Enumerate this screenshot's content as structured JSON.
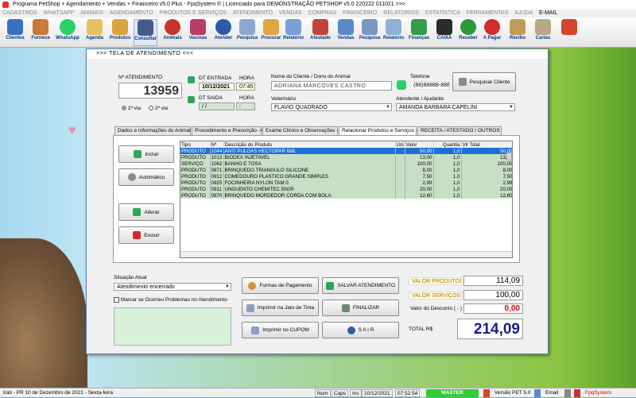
{
  "titlebar": {
    "text": "Programa PetShop + Agendamento + Vendas + Financeiro v5.0 Plus - FpqSystem ® | Licenciado para  DEMONSTRAÇÃO PETSHOP v5.0 220222 011021 >>>"
  },
  "menu": [
    "CADASTROS",
    "WHATSAPP",
    "ANIMAIS",
    "AGENDAMENTO",
    "PRODUTOS E SERVIÇOS",
    "ATENDIMENTO",
    "VENDAS",
    "COMPRAS",
    "FINANCEIRO",
    "RELATÓRIOS",
    "ESTATÍSTICA",
    "FERRAMENTAS",
    "AJUDA",
    "E-MAIL"
  ],
  "toolbar": {
    "clientes": "Clientes",
    "fornece": "Fornece",
    "whatsapp": "WhatsApp",
    "agenda": "Agenda",
    "produtos": "Produtos",
    "consultar": "Consultar",
    "animais": "Animais",
    "vacinas": "Vacinas",
    "atender": "Atender",
    "pesquisa": "Pesquisa",
    "procurar": "Procurar",
    "relatorio": "Relatório",
    "atestado": "Atestado",
    "vendas": "Vendas",
    "pesquisa2": "Pesquisa",
    "relatorio2": "Relatório",
    "financas": "Finanças",
    "caixa": "CAIXA",
    "receber": "Receber",
    "apagar": "A Pagar",
    "recibo": "Recibo",
    "cartas": "Cartas"
  },
  "dialog": {
    "title": ">>>   TELA DE ATENDIMENTO   <<<",
    "atendimento_label": "Nº ATENDIMENTO",
    "atendimento_number": "13959",
    "via1": "1ª via",
    "via2": "2ª via",
    "dt_entrada_label": "DT ENTRADA",
    "dt_entrada": "10/12/2021",
    "hora_label": "HORA",
    "hora_entrada": "07:45",
    "dt_saida_label": "DT SAIDA",
    "dt_saida": "  /  /",
    "hora_saida_label": "HORA",
    "hora_saida": "  :",
    "cliente_label": "Nome do Cliente / Dono do Animal",
    "cliente": "ADRIANA MARCOVES CASTRO",
    "telefone_label": "Telefone",
    "telefone": "(88)88888-8888",
    "pesquisar_cliente": "Pesquisar Cliente",
    "veterinario_label": "Veterinário",
    "veterinario": "FLAVIO QUADRADO",
    "atendente_label": "Atendente / Ajudante",
    "atendente": "AMANDA BARBARA CAPELINI",
    "tabs": [
      "Dados e informações do Animal  ->",
      "Procedimento e Prescrição  ->",
      "Exame Clínico e Observações  ->",
      "Relacionar Produtos e Serviços  ->",
      "RECEITA / ATESTADO / OUTROS"
    ],
    "incluir": "Incluir",
    "automatico": "Automático",
    "alterar": "Alterar",
    "excluir": "Excluir",
    "columns": [
      "Tipo",
      "Nº",
      "Descrição do Produto",
      "Uni",
      "Valor",
      "Quantia",
      "Vlr Total"
    ],
    "rows": [
      [
        "PRODUTO",
        "1044",
        "ANTI PULGAS HECTOPAR 6ML",
        "",
        "50,00",
        "1,0",
        "50,00"
      ],
      [
        "PRODUTO",
        "1013",
        "BIODEX INJETAVEL",
        "",
        "13,00",
        "1,0",
        "13,00"
      ],
      [
        "SERVIÇO",
        "1062",
        "BANHO E TOSA",
        "",
        "100,00",
        "1,0",
        "100,00"
      ],
      [
        "PRODUTO",
        "0871",
        "BRINQUEDO TRIANGULO SILICONE",
        "",
        "8,00",
        "1,0",
        "8,00"
      ],
      [
        "PRODUTO",
        "0912",
        "COMEDOURO PLASTICO GRANDE SIMPLES",
        "",
        "7,50",
        "1,0",
        "7,50"
      ],
      [
        "PRODUTO",
        "0925",
        "FOCINHEIRA NYLON TAM 0",
        "",
        "2,99",
        "1,0",
        "2,99"
      ],
      [
        "PRODUTO",
        "0911",
        "UNGUENTO CHEMITEC 50GR",
        "",
        "20,00",
        "1,0",
        "20,00"
      ],
      [
        "PRODUTO",
        "0870",
        "BRINQUEDO MORDEDOR CORDA COM BOLA",
        "",
        "12,60",
        "1,0",
        "12,60"
      ]
    ],
    "situacao_label": "Situação Atual",
    "situacao": "Atendimento encerrado",
    "problemas_label": "Marcar se Ocorreu Problemas no Atendimento",
    "formas_pagamento": "Formas de Pagamento",
    "salvar": "SALVAR  ATENDIMENTO",
    "imprimir_jato": "Imprimir na Jato de Tinta",
    "finalizar": "FINALIZAR",
    "imprimir_cupom": "Imprimir no CUPOM",
    "sair": "S A I R",
    "valor_produtos_label": "VALOR PRODUTOS",
    "valor_produtos": "114,09",
    "valor_servicos_label": "VALOR SERVIÇOS",
    "valor_servicos": "100,00",
    "desconto_label": "Valor do Desconto ( - )",
    "desconto": "0,00",
    "total_label": "TOTAL R$",
    "total": "214,09"
  },
  "statusbar": {
    "left": "Irati - PR 10 de Dezembro de 2021 - Sexta-feira",
    "num": "Num",
    "caps": "Caps",
    "ins": "Ins",
    "date": "10/12/2021",
    "time": "07:52:54",
    "master": "MASTER",
    "versao": "Versão PET 5.0",
    "email": "Email",
    "brand": "FpqSystem"
  },
  "colors": {
    "accent": "#00338f",
    "selected_row": "#1d6fd6",
    "row_bg": "#c7e0c4",
    "total_color": "#1a1a8c",
    "desconto_color": "#d00000"
  }
}
